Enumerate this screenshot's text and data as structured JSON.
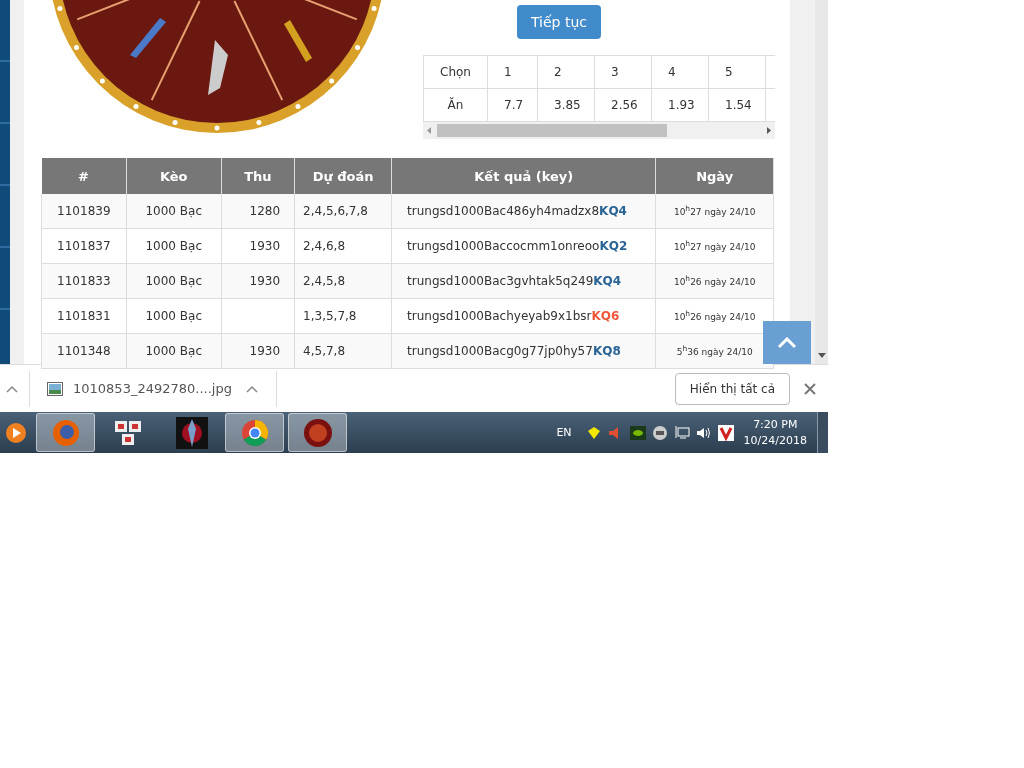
{
  "continue_button": {
    "label": "Tiếp tục"
  },
  "odds_table": {
    "rows": [
      {
        "label": "Chọn",
        "cells": [
          "1",
          "2",
          "3",
          "4",
          "5"
        ]
      },
      {
        "label": "Ăn",
        "cells": [
          "7.7",
          "3.85",
          "2.56",
          "1.93",
          "1.54"
        ]
      }
    ]
  },
  "history_table": {
    "columns": [
      "#",
      "Kèo",
      "Thu",
      "Dự đoán",
      "Kết quả (key)",
      "Ngày"
    ],
    "rows": [
      {
        "id": "1101839",
        "bet": "1000 Bạc",
        "win": "1280",
        "prediction": "2,4,5,6,7,8",
        "key": "trungsd1000Bac486yh4madzx8",
        "result": "KQ4",
        "color": "#2a6496",
        "date": "10$^{h}$27 ngày 24/10"
      },
      {
        "id": "1101837",
        "bet": "1000 Bạc",
        "win": "1930",
        "prediction": "2,4,6,8",
        "key": "trungsd1000Baccocmm1onreoo",
        "result": "KQ2",
        "color": "#2a6496",
        "date": "10$^{h}$27 ngày 24/10"
      },
      {
        "id": "1101833",
        "bet": "1000 Bạc",
        "win": "1930",
        "prediction": "2,4,5,8",
        "key": "trungsd1000Bac3gvhtak5q249",
        "result": "KQ4",
        "color": "#2a6496",
        "date": "10$^{h}$26 ngày 24/10"
      },
      {
        "id": "1101831",
        "bet": "1000 Bạc",
        "win": "",
        "prediction": "1,3,5,7,8",
        "key": "trungsd1000Bachyeyab9x1bsr",
        "result": "KQ6",
        "color": "#f0573a",
        "date": "10$^{h}$26 ngày 24/10"
      },
      {
        "id": "1101348",
        "bet": "1000 Bạc",
        "win": "1930",
        "prediction": "4,5,7,8",
        "key": "trungsd1000Bacg0g77jp0hy57",
        "result": "KQ8",
        "color": "#2a6496",
        "date": "5$^{h}$36 ngày 24/10"
      }
    ]
  },
  "download_bar": {
    "file": "1010853_2492780....jpg",
    "show_all": "Hiển thị tất cả"
  },
  "taskbar": {
    "language": "EN",
    "time": "7:20 PM",
    "date": "10/24/2018"
  }
}
